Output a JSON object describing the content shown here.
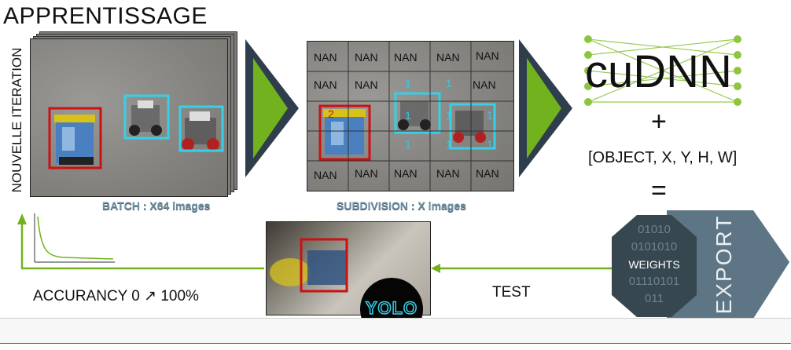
{
  "title": "APPRENTISSAGE",
  "vertical_label": "NOUVELLE ITERATION",
  "batch_caption": "BATCH : X64 images",
  "subdivision_caption": "SUBDIVISION : X images",
  "grid_nan_label": "NAN",
  "grid_one_label": "1",
  "grid_two_label": "2",
  "cudnn_logo_text": "cuDNN",
  "plus": "+",
  "formula": "[OBJECT, X, Y, H, W]",
  "equals": "=",
  "weights": {
    "lines": [
      "01010",
      "0101010",
      "WEIGHTS",
      "01110101",
      "011"
    ]
  },
  "export_label": "EXPORT",
  "test_label": "TEST",
  "accuracy_label": "ACCURANCY 0 ↗ 100%",
  "yolo_logo_text": "YOLO",
  "colors": {
    "arrow_green": "#72b21e",
    "arrow_border": "#2f3e4c",
    "box_red": "#cc1111",
    "box_cyan": "#38d0e8",
    "export_slate": "#5d7585",
    "weights_dark": "#37474f"
  }
}
